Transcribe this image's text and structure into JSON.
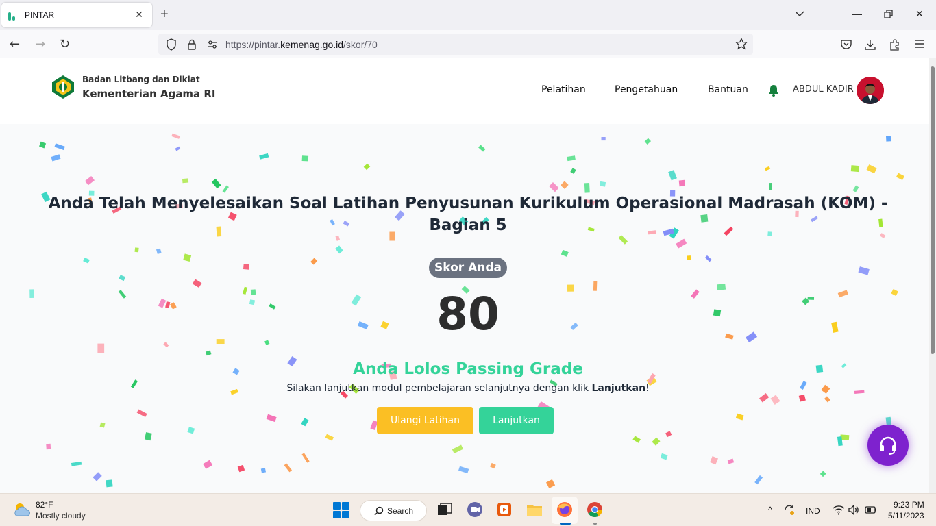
{
  "browser": {
    "tab_title": "PINTAR",
    "url_prefix": "https://pintar.",
    "url_domain": "kemenag.go.id",
    "url_path": "/skor/70"
  },
  "header": {
    "org_line1": "Badan Litbang dan Diklat",
    "org_line2": "Kementerian Agama RI",
    "menu": [
      {
        "label": "Pelatihan"
      },
      {
        "label": "Pengetahuan"
      },
      {
        "label": "Bantuan"
      }
    ],
    "user_name": "ABDUL KADIR"
  },
  "result": {
    "title": "Anda Telah Menyelesaikan Soal Latihan Penyusunan Kurikulum Operasional Madrasah (KOM) - Bagian 5",
    "score_label": "Skor Anda",
    "score": "80",
    "status": "Anda Lolos Passing Grade",
    "instruction_text": "Silakan lanjutkan modul pembelajaran selanjutnya dengan klik ",
    "instruction_bold": "Lanjutkan",
    "instruction_end": "!",
    "retry_button": "Ulangi Latihan",
    "next_button": "Lanjutkan"
  },
  "colors": {
    "brand_green": "#34d399",
    "retry_yellow": "#fbbf24",
    "fab_purple": "#7e22ce",
    "confetti": [
      "#f472b6",
      "#a3e635",
      "#fb923c",
      "#60a5fa",
      "#2dd4bf",
      "#f43f5e",
      "#facc15",
      "#818cf8",
      "#22c55e",
      "#5eead4",
      "#fda4af",
      "#4ade80"
    ]
  },
  "taskbar": {
    "temperature": "82°F",
    "weather": "Mostly cloudy",
    "search_label": "Search",
    "language": "IND",
    "time": "9:23 PM",
    "date": "5/11/2023"
  }
}
